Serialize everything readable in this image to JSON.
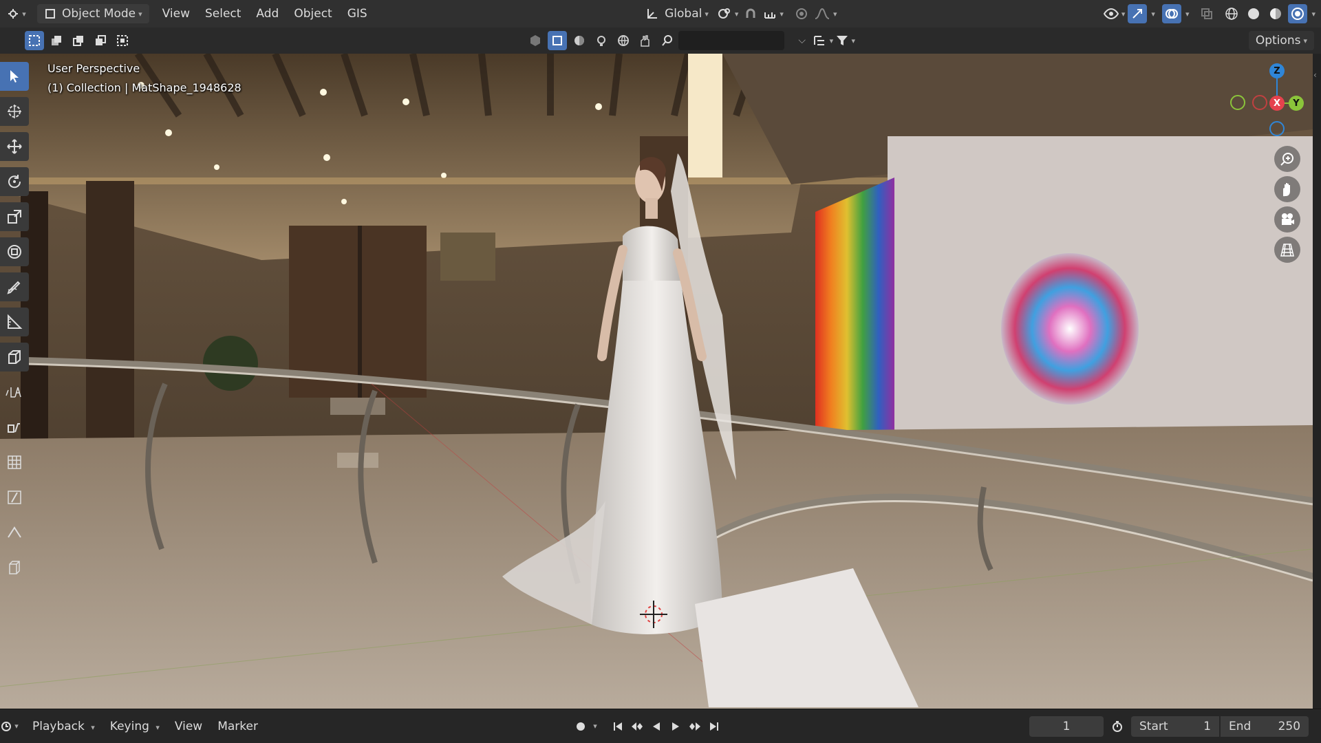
{
  "header": {
    "mode_label": "Object Mode",
    "menus": [
      "View",
      "Select",
      "Add",
      "Object",
      "GIS"
    ],
    "orientation_label": "Global"
  },
  "tool_header": {
    "options_label": "Options",
    "search_placeholder": ""
  },
  "viewport": {
    "perspective_label": "User Perspective",
    "collection_label": "(1) Collection | MatShape_1948628",
    "gizmo": {
      "x_label": "X",
      "y_label": "Y",
      "z_label": "Z"
    },
    "colors": {
      "x": "#e5424d",
      "y": "#8bc43a",
      "z": "#2f86d8"
    }
  },
  "timeline": {
    "menus": [
      "Playback",
      "Keying",
      "View",
      "Marker"
    ],
    "current_frame": "1",
    "start_label": "Start",
    "start_value": "1",
    "end_label": "End",
    "end_value": "250"
  },
  "colors": {
    "accent": "#4772b3",
    "header_bg": "#303030"
  }
}
